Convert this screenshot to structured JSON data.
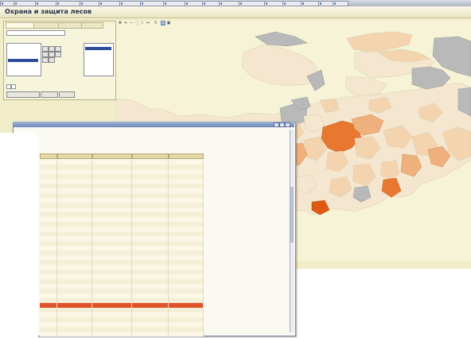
{
  "taskbar": {
    "tasks": [
      "",
      "",
      "",
      "",
      "",
      "",
      "",
      "",
      "",
      "",
      "",
      "",
      "",
      "",
      "",
      "",
      "",
      ""
    ]
  },
  "app": {
    "title": "Охрана и защита лесов",
    "user_link": ""
  },
  "left_panel": {
    "tabs": [
      "",
      "",
      "",
      ""
    ],
    "region_select": "",
    "layer_items": [
      "",
      "",
      "",
      "",
      ""
    ],
    "extra_label": "",
    "checkbox_label": "",
    "buttons": [
      "",
      "",
      ""
    ]
  },
  "map": {
    "labels": [
      "",
      "",
      ""
    ],
    "colors": {
      "gray": "#b9b9b9",
      "pale": "#f5e7cf",
      "light": "#f3d4ae",
      "mid": "#eeb07c",
      "dark": "#e8772f",
      "deep": "#de5a14"
    }
  },
  "popup": {
    "title": "",
    "report_title": "",
    "report_sub": "",
    "columns": [
      "",
      "",
      "",
      "",
      ""
    ],
    "rows": [
      [
        "",
        "",
        "",
        "",
        ""
      ],
      [
        "",
        "",
        "",
        "",
        ""
      ],
      [
        "",
        "",
        "",
        "",
        ""
      ],
      [
        "",
        "",
        "",
        "",
        ""
      ],
      [
        "",
        "",
        "",
        "",
        ""
      ],
      [
        "",
        "",
        "",
        "",
        ""
      ],
      [
        "",
        "",
        "",
        "",
        ""
      ],
      [
        "",
        "",
        "",
        "",
        ""
      ],
      [
        "",
        "",
        "",
        "",
        ""
      ],
      [
        "",
        "",
        "",
        "",
        ""
      ],
      [
        "",
        "",
        "",
        "",
        ""
      ],
      [
        "",
        "",
        "",
        "",
        ""
      ],
      [
        "",
        "",
        "",
        "",
        ""
      ],
      [
        "",
        "",
        "",
        "",
        ""
      ],
      [
        "",
        "",
        "",
        "",
        ""
      ],
      [
        "",
        "",
        "",
        "",
        ""
      ],
      [
        "",
        "",
        "",
        "",
        ""
      ],
      [
        "",
        "",
        "",
        "",
        ""
      ],
      [
        "",
        "",
        "",
        "",
        ""
      ],
      [
        "",
        "",
        "",
        "",
        ""
      ],
      [
        "",
        "",
        "",
        "",
        ""
      ],
      [
        "",
        "",
        "",
        "",
        ""
      ],
      [
        "",
        "",
        "",
        "",
        ""
      ],
      [
        "",
        "",
        "",
        "",
        ""
      ],
      [
        "",
        "",
        "",
        "",
        ""
      ],
      [
        "",
        "",
        "",
        "",
        ""
      ],
      [
        "",
        "",
        "",
        "",
        ""
      ],
      [
        "",
        "",
        "",
        "",
        ""
      ],
      [
        "",
        "",
        "",
        "",
        ""
      ],
      [
        "",
        "",
        "",
        "",
        ""
      ],
      [
        "",
        "",
        "",
        "",
        ""
      ],
      [
        "",
        "",
        "",
        "",
        ""
      ],
      [
        "",
        "",
        "",
        "",
        ""
      ],
      [
        "",
        "",
        "",
        "",
        ""
      ],
      [
        "",
        "",
        "",
        "",
        ""
      ],
      [
        "",
        "",
        "",
        "",
        ""
      ],
      [
        "",
        "",
        "",
        "",
        ""
      ]
    ],
    "highlighted_row": 30,
    "highlight_color": "#e0522a"
  }
}
